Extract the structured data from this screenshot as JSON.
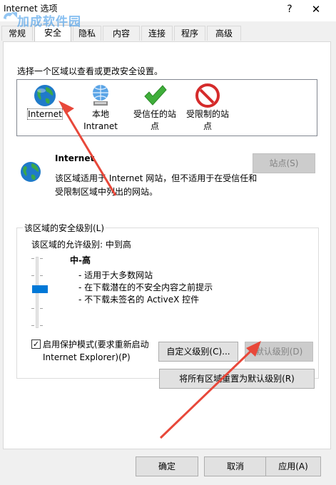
{
  "window": {
    "title": "Internet 选项",
    "help": "?",
    "close": "✕"
  },
  "watermark": "加成软件园",
  "tabs": [
    {
      "label": "常规",
      "active": false
    },
    {
      "label": "安全",
      "active": true
    },
    {
      "label": "隐私",
      "active": false
    },
    {
      "label": "内容",
      "active": false
    },
    {
      "label": "连接",
      "active": false
    },
    {
      "label": "程序",
      "active": false
    },
    {
      "label": "高级",
      "active": false
    }
  ],
  "instruction": "选择一个区域以查看或更改安全设置。",
  "zones": [
    {
      "label_line1": "Internet",
      "label_line2": "",
      "icon": "globe-icon",
      "selected": true
    },
    {
      "label_line1": "本地",
      "label_line2": "Intranet",
      "icon": "network-globe-icon",
      "selected": false
    },
    {
      "label_line1": "受信任的站",
      "label_line2": "点",
      "icon": "checkmark-icon",
      "selected": false
    },
    {
      "label_line1": "受限制的站",
      "label_line2": "点",
      "icon": "no-entry-icon",
      "selected": false
    }
  ],
  "zone_info": {
    "title": "Internet",
    "description": "该区域适用于 Internet 网站，但不适用于在受信任和受限制区域中列出的网站。",
    "sites_button": "站点(S)"
  },
  "security_group": {
    "legend": "该区域的安全级别(L)",
    "allowed": "该区域的允许级别: 中到高",
    "level_title": "中-高",
    "level_items": [
      "- 适用于大多数网站",
      "- 在下载潜在的不安全内容之前提示",
      "- 不下载未签名的 ActiveX 控件"
    ],
    "protected_mode_label": "启用保护模式(要求重新启动 Internet Explorer)(P)",
    "protected_mode_checked": true,
    "custom_level_button": "自定义级别(C)...",
    "default_level_button": "默认级别(D)"
  },
  "reset_all_button": "将所有区域重置为默认级别(R)",
  "footer": {
    "ok": "确定",
    "cancel": "取消",
    "apply": "应用(A)"
  },
  "colors": {
    "accent": "#0078d7",
    "annotation_arrow": "#e8483a"
  }
}
